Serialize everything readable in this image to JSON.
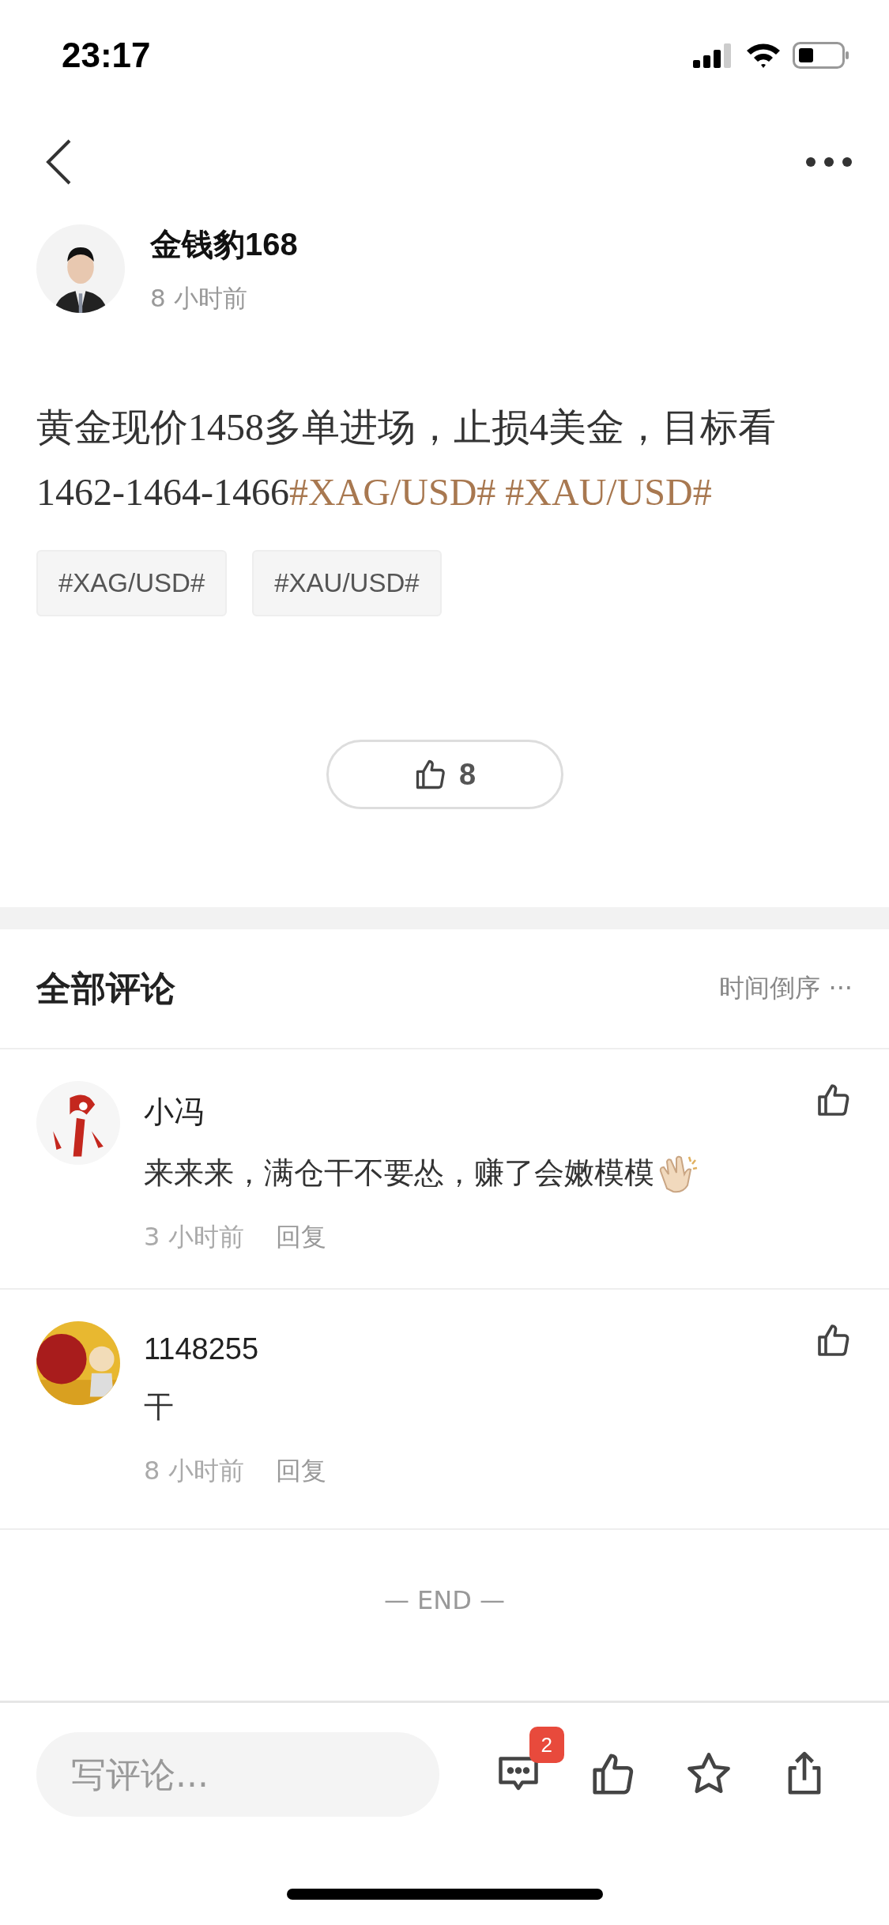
{
  "status_bar": {
    "time": "23:17"
  },
  "author": {
    "name": "金钱豹168",
    "time": "8 小时前"
  },
  "post": {
    "segments": [
      {
        "kind": "text",
        "text": "黄金现价1458多单进场，止损4美金，目标看1462-1464-1466"
      },
      {
        "kind": "hashtag",
        "text": "#XAG/USD#"
      },
      {
        "kind": "hashtag",
        "text": "#XAU/USD#"
      }
    ],
    "tags": [
      "#XAG/USD#",
      "#XAU/USD#"
    ],
    "likes": "8"
  },
  "comments_header": {
    "title": "全部评论",
    "sort": "时间倒序",
    "sort_more": "···"
  },
  "comments": [
    {
      "name": "小冯",
      "text": "来来来，满仓干不要怂，赚了会嫩模模",
      "emoji": true,
      "time": "3 小时前",
      "reply": "回复"
    },
    {
      "name": "1148255",
      "text": "干",
      "emoji": false,
      "time": "8 小时前",
      "reply": "回复"
    }
  ],
  "end_label": "— END —",
  "bottom_bar": {
    "placeholder": "写评论...",
    "comment_badge": "2"
  }
}
